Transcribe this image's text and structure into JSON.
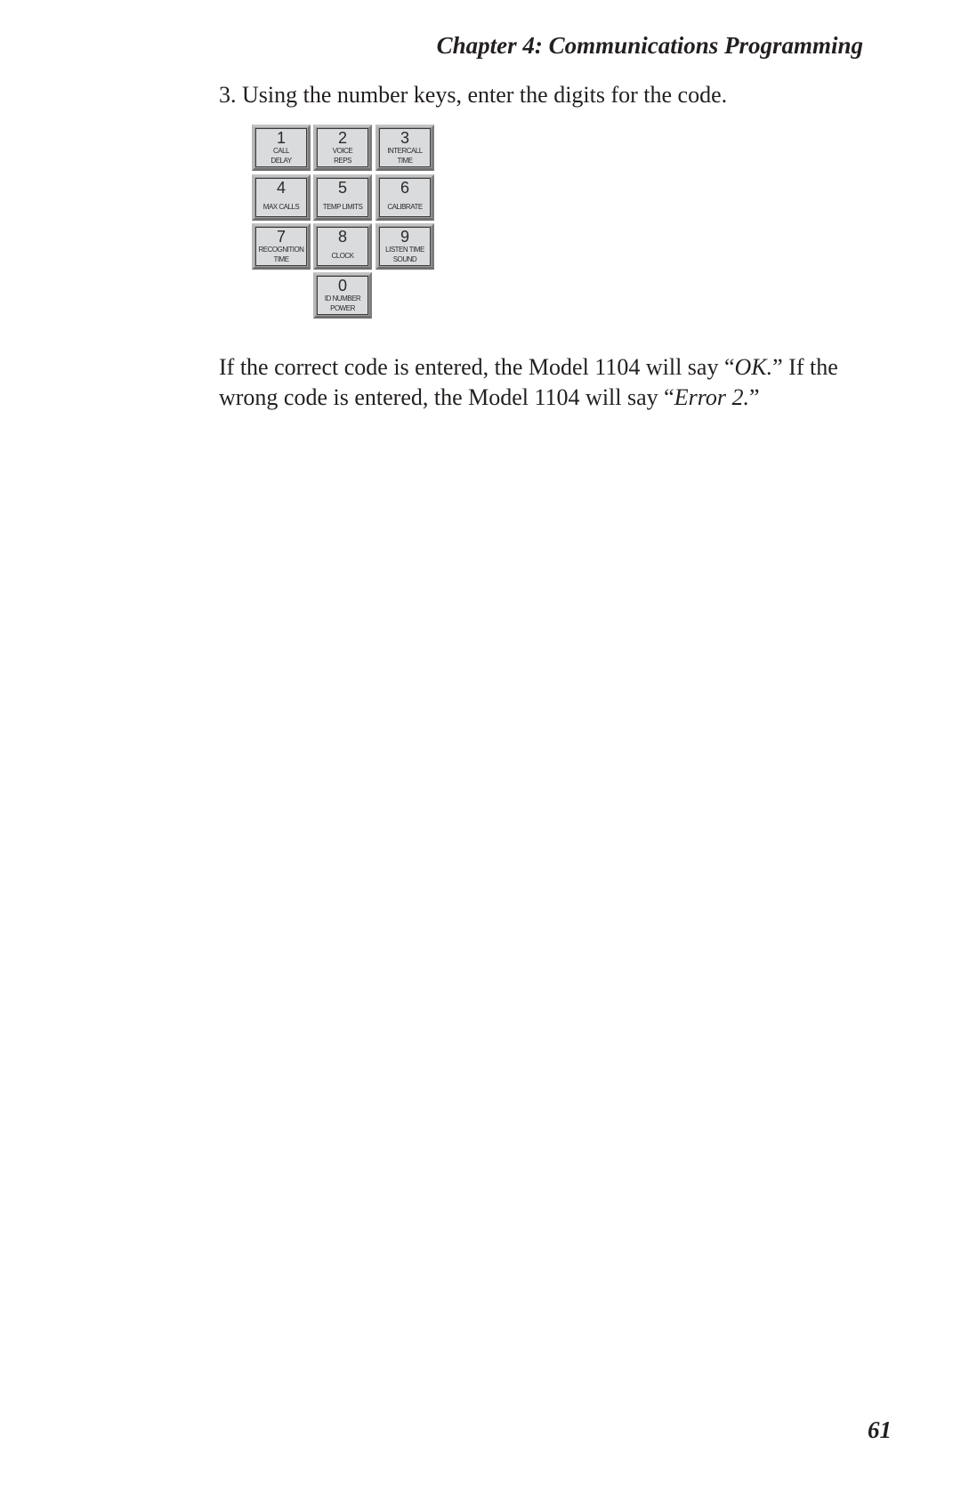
{
  "header": {
    "title": "Chapter 4:  Communications Programming"
  },
  "step": {
    "text": "3.  Using the number keys, enter the digits for the code."
  },
  "keypad": {
    "keys": [
      {
        "digit": "1",
        "label_lines": [
          "CALL",
          "DELAY"
        ]
      },
      {
        "digit": "2",
        "label_lines": [
          "VOICE",
          "REPS"
        ]
      },
      {
        "digit": "3",
        "label_lines": [
          "INTERCALL",
          "TIME"
        ]
      },
      {
        "digit": "4",
        "label_lines": [
          "MAX CALLS"
        ]
      },
      {
        "digit": "5",
        "label_lines": [
          "TEMP LIMITS"
        ]
      },
      {
        "digit": "6",
        "label_lines": [
          "CALIBRATE"
        ]
      },
      {
        "digit": "7",
        "label_lines": [
          "RECOGNITION",
          "TIME"
        ]
      },
      {
        "digit": "8",
        "label_lines": [
          "CLOCK"
        ]
      },
      {
        "digit": "9",
        "label_lines": [
          "LISTEN TIME",
          "SOUND"
        ]
      },
      {
        "digit": "0",
        "label_lines": [
          "ID NUMBER",
          "POWER"
        ]
      }
    ]
  },
  "paragraph": {
    "part1": "If the correct code is entered, the Model 1104 will say “",
    "ok": "OK.",
    "part2": "”  If the wrong code is entered, the Model 1104 will say “",
    "error": "Error 2.",
    "part3": "”"
  },
  "page_number": "61"
}
